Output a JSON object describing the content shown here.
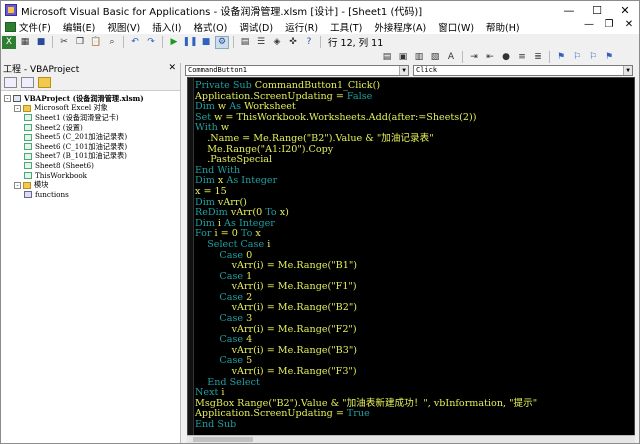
{
  "window": {
    "title": "Microsoft Visual Basic for Applications - 设备润滑管理.xlsm [设计] - [Sheet1 (代码)]",
    "controls": [
      "—",
      "☐",
      "✕"
    ]
  },
  "menu": {
    "items": [
      "文件(F)",
      "编辑(E)",
      "视图(V)",
      "插入(I)",
      "格式(O)",
      "调试(D)",
      "运行(R)",
      "工具(T)",
      "外接程序(A)",
      "窗口(W)",
      "帮助(H)"
    ],
    "right_controls": [
      "—",
      "❐",
      "✕"
    ]
  },
  "toolbar": {
    "position_text": "行 12, 列 11"
  },
  "project": {
    "header": "工程 - VBAProject",
    "close": "✕",
    "tree": [
      {
        "text": "VBAProject (设备润滑管理.xlsm)",
        "level": 0,
        "type": "project",
        "expander": "-"
      },
      {
        "text": "Microsoft Excel 对象",
        "level": 1,
        "type": "folder",
        "expander": "-"
      },
      {
        "text": "Sheet1 (设备润滑登记卡)",
        "level": 2,
        "type": "sheet"
      },
      {
        "text": "Sheet2 (设置)",
        "level": 2,
        "type": "sheet"
      },
      {
        "text": "Sheet5 (C_201加油记录表)",
        "level": 2,
        "type": "sheet"
      },
      {
        "text": "Sheet6 (C_101加油记录表)",
        "level": 2,
        "type": "sheet"
      },
      {
        "text": "Sheet7 (B_101加油记录表)",
        "level": 2,
        "type": "sheet"
      },
      {
        "text": "Sheet8 (Sheet6)",
        "level": 2,
        "type": "sheet"
      },
      {
        "text": "ThisWorkbook",
        "level": 2,
        "type": "sheet"
      },
      {
        "text": "模块",
        "level": 1,
        "type": "folder",
        "expander": "-"
      },
      {
        "text": "functions",
        "level": 2,
        "type": "module"
      }
    ]
  },
  "code": {
    "object_combo": "CommandButton1",
    "proc_combo": "Click",
    "lines": [
      {
        "kw": "Private Sub ",
        "t": "CommandButton1_Click()"
      },
      {
        "kw": "",
        "t": "Application.ScreenUpdating = ",
        "kw2": "False"
      },
      {
        "kw": "Dim ",
        "t": "w ",
        "kw2": "As ",
        "t2": "Worksheet"
      },
      {
        "kw": "Set ",
        "t": "w = ThisWorkbook.Worksheets.Add(after:=Sheets(2))"
      },
      {
        "kw": "With ",
        "t": "w"
      },
      {
        "kw": "",
        "t": "    .Name = Me.Range(\"B2\").Value & \"加油记录表\""
      },
      {
        "kw": "",
        "t": "    Me.Range(\"A1:I20\").Copy"
      },
      {
        "kw": "",
        "t": "    .PasteSpecial"
      },
      {
        "kw": "End With",
        "t": ""
      },
      {
        "kw": "Dim ",
        "t": "x ",
        "kw2": "As Integer"
      },
      {
        "kw": "",
        "t": "x = 15"
      },
      {
        "kw": "Dim ",
        "t": "vArr()"
      },
      {
        "kw": "ReDim ",
        "t": "vArr(0 ",
        "kw2": "To ",
        "t2": "x)"
      },
      {
        "kw": "Dim ",
        "t": "i ",
        "kw2": "As Integer"
      },
      {
        "kw": "For ",
        "t": "i = 0 ",
        "kw2": "To ",
        "t2": "x"
      },
      {
        "kw": "    Select Case ",
        "t": "i"
      },
      {
        "kw": "        Case ",
        "t": "0"
      },
      {
        "kw": "",
        "t": "            vArr(i) = Me.Range(\"B1\")"
      },
      {
        "kw": "        Case ",
        "t": "1"
      },
      {
        "kw": "",
        "t": "            vArr(i) = Me.Range(\"F1\")"
      },
      {
        "kw": "        Case ",
        "t": "2"
      },
      {
        "kw": "",
        "t": "            vArr(i) = Me.Range(\"B2\")"
      },
      {
        "kw": "        Case ",
        "t": "3"
      },
      {
        "kw": "",
        "t": "            vArr(i) = Me.Range(\"F2\")"
      },
      {
        "kw": "        Case ",
        "t": "4"
      },
      {
        "kw": "",
        "t": "            vArr(i) = Me.Range(\"B3\")"
      },
      {
        "kw": "        Case ",
        "t": "5"
      },
      {
        "kw": "",
        "t": "            vArr(i) = Me.Range(\"F3\")"
      },
      {
        "kw": "    End Select",
        "t": ""
      },
      {
        "kw": "Next ",
        "t": "i"
      },
      {
        "kw": "",
        "t": "MsgBox Range(\"B2\").Value & \"加油表新建成功！\", vbInformation, \"提示\""
      },
      {
        "kw": "",
        "t": "Application.ScreenUpdating = ",
        "kw2": "True"
      },
      {
        "kw": "End Sub",
        "t": ""
      }
    ]
  },
  "colors": {
    "keyword": "#1fa0a0",
    "text": "#e6f05a",
    "editor_bg": "#000000"
  }
}
